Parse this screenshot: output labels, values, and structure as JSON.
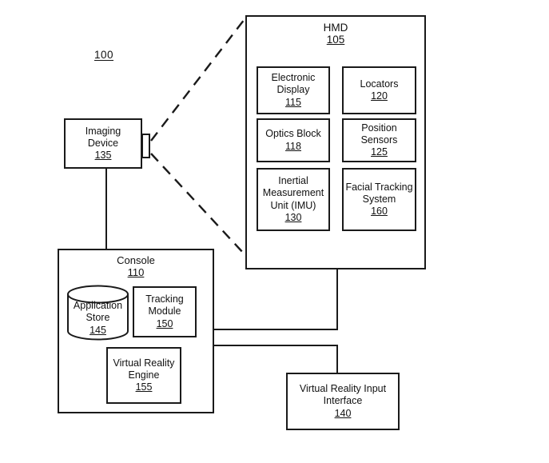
{
  "figure": {
    "number": "100"
  },
  "hmd": {
    "title": "HMD",
    "number": "105",
    "components": [
      {
        "label": "Electronic\nDisplay",
        "number": "115",
        "name": "electronic-display"
      },
      {
        "label": "Locators",
        "number": "120",
        "name": "locators"
      },
      {
        "label": "Optics Block",
        "number": "118",
        "name": "optics-block"
      },
      {
        "label": "Position\nSensors",
        "number": "125",
        "name": "position-sensors"
      },
      {
        "label": "Inertial\nMeasurement\nUnit (IMU)",
        "number": "130",
        "name": "inertial-measurement-unit"
      },
      {
        "label": "Facial Tracking\nSystem",
        "number": "160",
        "name": "facial-tracking-system"
      }
    ]
  },
  "imaging_device": {
    "label": "Imaging\nDevice",
    "number": "135"
  },
  "console": {
    "title": "Console",
    "number": "110",
    "components": [
      {
        "label": "Application\nStore",
        "number": "145",
        "name": "application-store"
      },
      {
        "label": "Tracking\nModule",
        "number": "150",
        "name": "tracking-module"
      },
      {
        "label": "Virtual Reality\nEngine",
        "number": "155",
        "name": "virtual-reality-engine"
      }
    ]
  },
  "vr_input_interface": {
    "label": "Virtual Reality Input\nInterface",
    "number": "140"
  },
  "colors": {
    "stroke": "#1a1a1a",
    "background": "#ffffff",
    "text": "#111111"
  }
}
